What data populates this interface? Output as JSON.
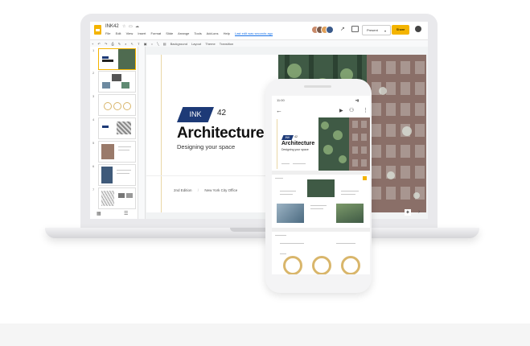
{
  "app": {
    "doc_title": "INK42",
    "menu": [
      "File",
      "Edit",
      "View",
      "Insert",
      "Format",
      "Slide",
      "Arrange",
      "Tools",
      "Add-ons",
      "Help"
    ],
    "last_edit": "Last edit was seconds ago",
    "present_label": "Present",
    "share_label": "Share",
    "toolbar": [
      "Background",
      "Layout",
      "Theme",
      "Transition"
    ]
  },
  "slide": {
    "badge": "INK",
    "number": "42",
    "title": "Architecture",
    "subtitle": "Designing your space",
    "edition": "2nd Edition",
    "separator": "/",
    "location": "New York City Office"
  },
  "filmstrip": {
    "numbers": [
      "1",
      "2",
      "3",
      "4",
      "5",
      "6",
      "7"
    ]
  },
  "phone": {
    "time": "11:00",
    "slide_title": "Architecture",
    "slide_subtitle": "Designing your space",
    "badge": "INK",
    "number": "42"
  },
  "colors": {
    "accent": "#f4b400",
    "brand_navy": "#1d3a77",
    "gold": "#d9b66b"
  }
}
